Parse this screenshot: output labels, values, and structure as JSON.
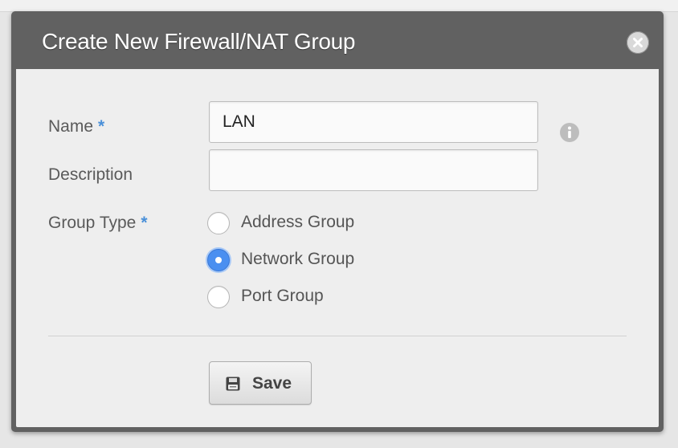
{
  "dialog": {
    "title": "Create New Firewall/NAT Group",
    "close_icon": "close-icon"
  },
  "form": {
    "name": {
      "label": "Name",
      "required_marker": "*",
      "value": "LAN",
      "info_icon": "info-icon"
    },
    "description": {
      "label": "Description",
      "value": ""
    },
    "group_type": {
      "label": "Group Type",
      "required_marker": "*",
      "selected": "Network Group",
      "options": [
        {
          "label": "Address Group",
          "checked": false
        },
        {
          "label": "Network Group",
          "checked": true
        },
        {
          "label": "Port Group",
          "checked": false
        }
      ]
    }
  },
  "actions": {
    "save_label": "Save",
    "save_icon": "floppy-disk-icon"
  },
  "colors": {
    "header_bg": "#616161",
    "body_bg": "#eeeeee",
    "required_accent": "#4a90d9",
    "radio_checked": "#4a8ff0"
  }
}
